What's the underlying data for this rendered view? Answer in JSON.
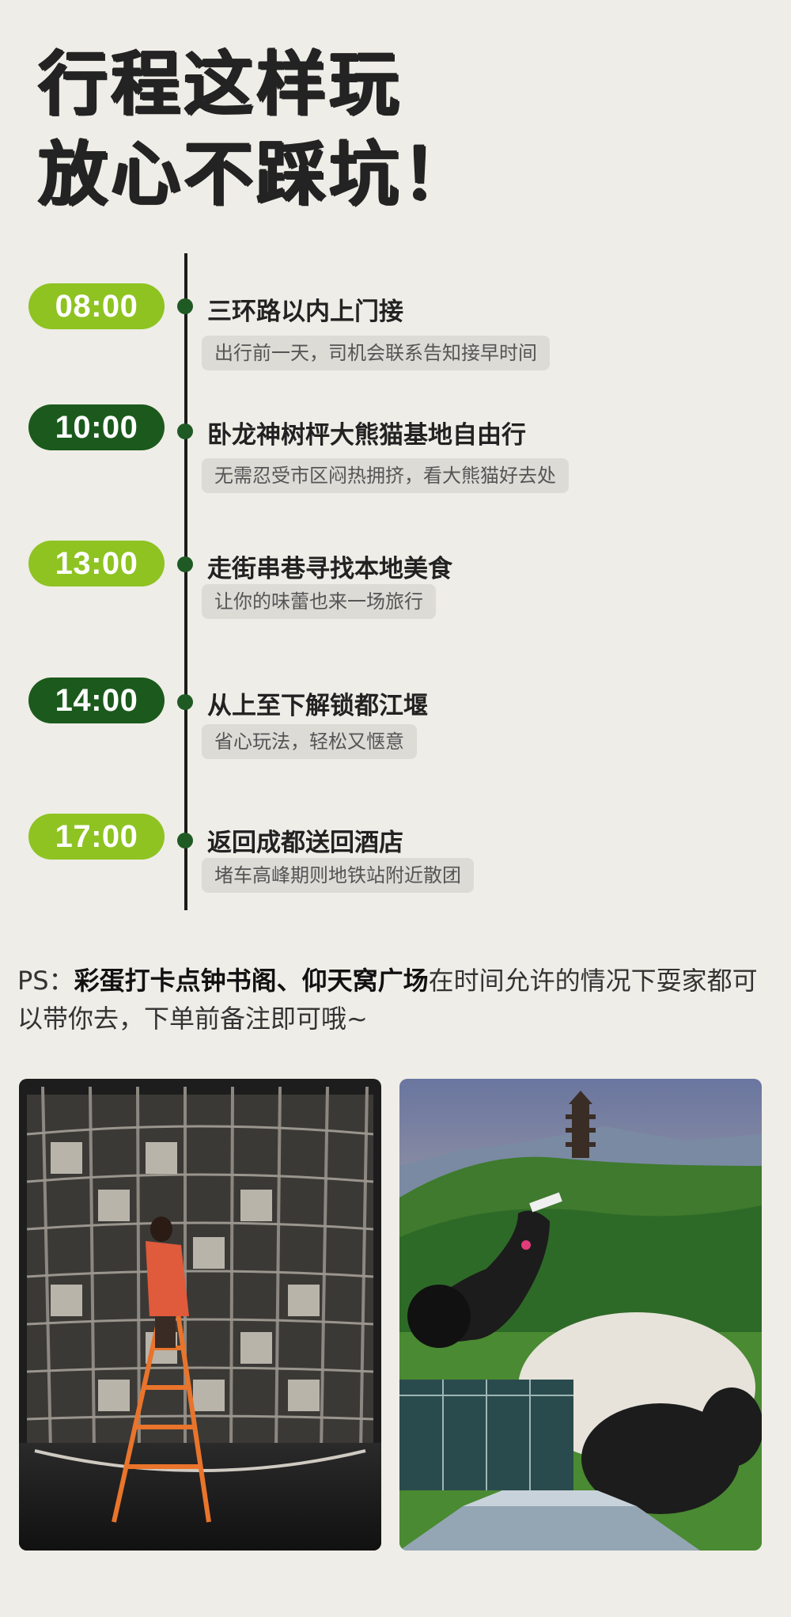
{
  "header": {
    "line1": "行程这样玩",
    "line2": "放心不踩坑！"
  },
  "colors": {
    "light_green": "#8ec322",
    "dark_green": "#1b5a1c"
  },
  "schedule": [
    {
      "time": "08:00",
      "title": "三环路以内上门接",
      "note": "出行前一天，司机会联系告知接早时间",
      "pill_color": "#8ec322"
    },
    {
      "time": "10:00",
      "title": "卧龙神树枰大熊猫基地自由行",
      "note": "无需忍受市区闷热拥挤，看大熊猫好去处",
      "pill_color": "#1b5a1c"
    },
    {
      "time": "13:00",
      "title": "走街串巷寻找本地美食",
      "note": "让你的味蕾也来一场旅行",
      "pill_color": "#8ec322"
    },
    {
      "time": "14:00",
      "title": "从上至下解锁都江堰",
      "note": "省心玩法，轻松又惬意",
      "pill_color": "#1b5a1c"
    },
    {
      "time": "17:00",
      "title": "返回成都送回酒店",
      "note": "堵车高峰期则地铁站附近散团",
      "pill_color": "#8ec322"
    }
  ],
  "ps": {
    "prefix": "PS：",
    "highlight": "彩蛋打卡点钟书阁、仰天窝广场",
    "rest": "在时间允许的情况下耍家都可以带你去，下单前备注即可哦~"
  },
  "photos": [
    {
      "name": "bookstore-photo"
    },
    {
      "name": "panda-sculpture-photo"
    }
  ]
}
